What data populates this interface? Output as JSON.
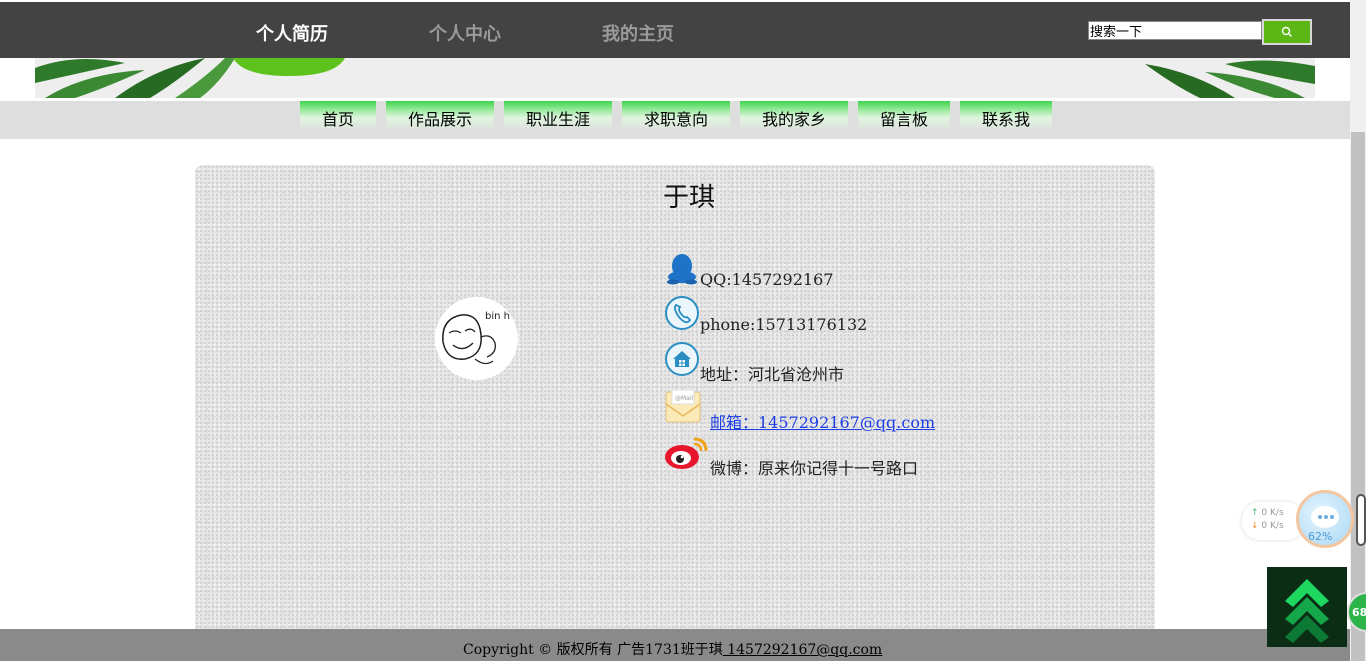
{
  "topnav": {
    "items": [
      "个人简历",
      "个人中心",
      "我的主页"
    ]
  },
  "search": {
    "value": "搜索一下"
  },
  "menu": {
    "items": [
      "首页",
      "作品展示",
      "职业生涯",
      "求职意向",
      "我的家乡",
      "留言板",
      "联系我"
    ]
  },
  "profile": {
    "name": "于琪",
    "qq": "QQ:1457292167",
    "phone": "phone:15713176132",
    "address": "地址：河北省沧州市",
    "email": "邮箱：1457292167@qq.com",
    "weibo": "微博：原来你记得十一号路口",
    "avatar_text": "bin h"
  },
  "footer": {
    "text": "Copyright © 版权所有 广告1731班于琪",
    "email": " 1457292167@qq.com"
  },
  "widgets": {
    "net_up": "0  K/s",
    "net_down": "0  K/s",
    "bubble_percent": "62%",
    "circle_badge": "68"
  },
  "colors": {
    "topbar": "#434343",
    "accent_green": "#5cb615",
    "menu_bg": "#dedede",
    "footer_bg": "#8a8a8a",
    "link_blue": "#1d3ee6"
  },
  "icons": {
    "qq": "qq-penguin-icon",
    "phone": "phone-icon",
    "address": "home-icon",
    "email": "mail-envelope-icon",
    "weibo": "weibo-icon",
    "search": "search-icon",
    "back_to_top": "double-chevron-up-icon"
  }
}
